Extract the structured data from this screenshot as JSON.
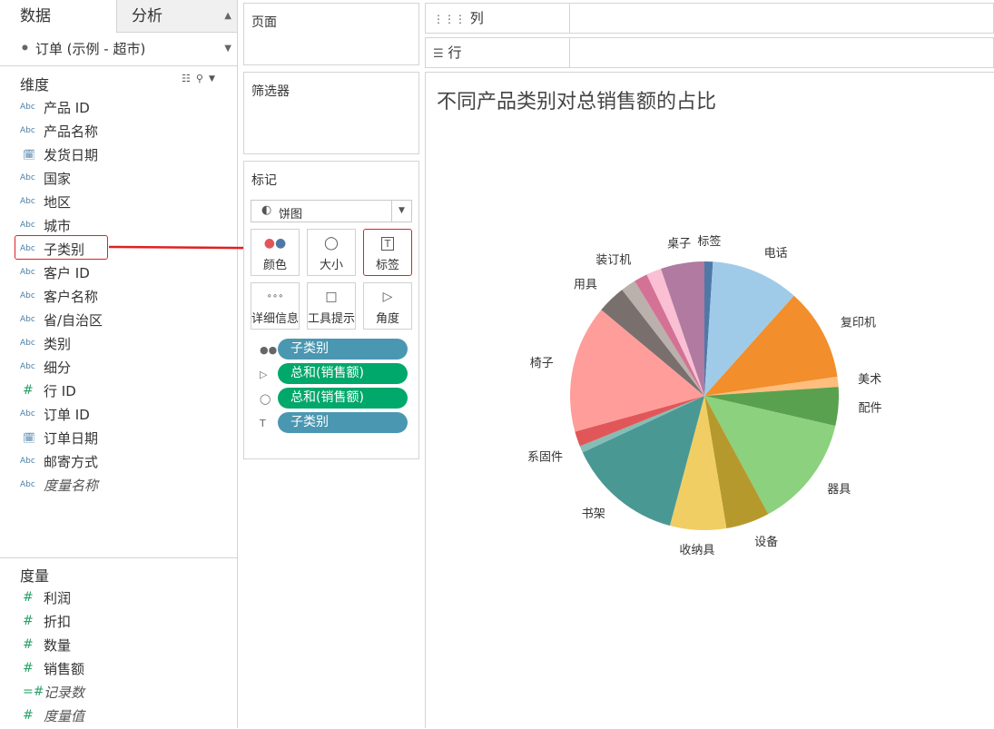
{
  "left_pane": {
    "tab_data": "数据",
    "tab_analysis": "分析",
    "datasource": "订单 (示例 - 超市)",
    "dimensions_title": "维度",
    "dimensions": [
      {
        "type": "Abc",
        "label": "产品 ID"
      },
      {
        "type": "Abc",
        "label": "产品名称"
      },
      {
        "type": "date",
        "label": "发货日期"
      },
      {
        "type": "Abc",
        "label": "国家"
      },
      {
        "type": "Abc",
        "label": "地区"
      },
      {
        "type": "Abc",
        "label": "城市"
      },
      {
        "type": "Abc",
        "label": "子类别"
      },
      {
        "type": "Abc",
        "label": "客户 ID"
      },
      {
        "type": "Abc",
        "label": "客户名称"
      },
      {
        "type": "Abc",
        "label": "省/自治区"
      },
      {
        "type": "Abc",
        "label": "类别"
      },
      {
        "type": "Abc",
        "label": "细分"
      },
      {
        "type": "#",
        "label": "行 ID"
      },
      {
        "type": "Abc",
        "label": "订单 ID"
      },
      {
        "type": "date",
        "label": "订单日期"
      },
      {
        "type": "Abc",
        "label": "邮寄方式"
      },
      {
        "type": "Abc",
        "label": "度量名称"
      }
    ],
    "measures_title": "度量",
    "measures": [
      {
        "type": "#",
        "label": "利润"
      },
      {
        "type": "#",
        "label": "折扣"
      },
      {
        "type": "#",
        "label": "数量"
      },
      {
        "type": "#",
        "label": "销售额"
      },
      {
        "type": "=#",
        "label": "记录数"
      },
      {
        "type": "#",
        "label": "度量值"
      }
    ]
  },
  "shelves": {
    "pages": "页面",
    "filters": "筛选器",
    "marks": "标记",
    "marks_type": "饼图",
    "columns": "列",
    "rows": "行"
  },
  "marks_buttons": [
    "颜色",
    "大小",
    "标签",
    "详细信息",
    "工具提示",
    "角度"
  ],
  "marks_pills": [
    {
      "icon": "color-icon",
      "label": "子类别",
      "kind": "dimension"
    },
    {
      "icon": "angle-icon",
      "label": "总和(销售额)",
      "kind": "measure"
    },
    {
      "icon": "size-icon",
      "label": "总和(销售额)",
      "kind": "measure"
    },
    {
      "icon": "label-icon",
      "label": "子类别",
      "kind": "dimension"
    }
  ],
  "chart_data": {
    "type": "pie",
    "title": "不同产品类别对总销售额的占比",
    "slices": [
      {
        "name": "标签",
        "value": 1.0,
        "color": "#4e79a7"
      },
      {
        "name": "电话",
        "value": 10.5,
        "color": "#a0cbe8"
      },
      {
        "name": "复印机",
        "value": 11.0,
        "color": "#f28e2b"
      },
      {
        "name": "美术",
        "value": 1.2,
        "color": "#ffbe7d"
      },
      {
        "name": "配件",
        "value": 4.6,
        "color": "#59a14f"
      },
      {
        "name": "器具",
        "value": 13.4,
        "color": "#8cd17d"
      },
      {
        "name": "设备",
        "value": 5.2,
        "color": "#b6992d"
      },
      {
        "name": "收纳具",
        "value": 6.7,
        "color": "#f1ce63"
      },
      {
        "name": "书架",
        "value": 13.8,
        "color": "#499894"
      },
      {
        "name": "系固件",
        "value": 0.8,
        "color": "#86bcb6"
      },
      {
        "name": "",
        "value": 1.8,
        "color": "#e15759"
      },
      {
        "name": "椅子",
        "value": 15.2,
        "color": "#ff9d9a"
      },
      {
        "name": "用具",
        "value": 3.4,
        "color": "#79706e"
      },
      {
        "name": "",
        "value": 1.8,
        "color": "#bab0ac"
      },
      {
        "name": "装订机",
        "value": 1.6,
        "color": "#d37295"
      },
      {
        "name": "",
        "value": 1.8,
        "color": "#fabfd2"
      },
      {
        "name": "桌子",
        "value": 5.2,
        "color": "#b07aa1"
      }
    ]
  }
}
